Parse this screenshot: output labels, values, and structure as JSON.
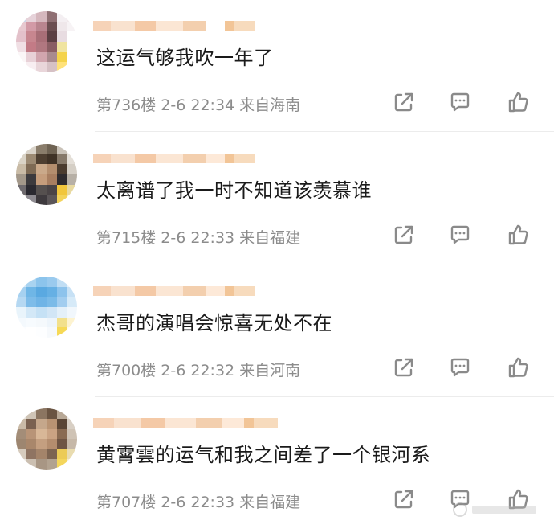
{
  "comments": [
    {
      "text": "这运气够我吹一年了",
      "meta": "第736楼 2-6 22:34 来自海南",
      "avatar_colors": [
        "#cbd6e8",
        "#e6d2d9",
        "#d5b7bd",
        "#8f6f73",
        "#f4eff2",
        "#f1e9ec",
        "#e7c8cf",
        "#d29aa6",
        "#b9858f",
        "#6c4e51",
        "#efe7ea",
        "#f7f3f5",
        "#e3c1ca",
        "#c7868f",
        "#a86e77",
        "#5c3f43",
        "#e8dce1",
        "#ffffff",
        "#f0dfe4",
        "#c37b86",
        "#b07780",
        "#8a5e64",
        "#f0e4a0",
        "#ffffff",
        "#fbf6f7",
        "#e8d1d7",
        "#d1a5ae",
        "#a98a8e",
        "#f4d34a",
        "#ffffff",
        "#ffffff",
        "#f8eef1",
        "#e9d6da",
        "#d6c1c5",
        "#ffe27a",
        "#ffffff"
      ],
      "name_colors": [
        "#f6d3b8",
        "#f9e2cf",
        "#f4c9a6",
        "#fbe6d4",
        "#f3cfae",
        "#ffffff",
        "#f2c597",
        "#f7dbbd"
      ]
    },
    {
      "text": "太离谱了我一时不知道该羡慕谁",
      "meta": "第715楼 2-6 22:33 来自福建",
      "avatar_colors": [
        "#e9e6e0",
        "#d9d3c9",
        "#8a7d6b",
        "#6f6353",
        "#c9c2b8",
        "#ece8e2",
        "#dad3c6",
        "#9c8a73",
        "#4e3f31",
        "#3f3226",
        "#86796a",
        "#e4dfd8",
        "#c9bba6",
        "#7e6a54",
        "#caa98a",
        "#b48e6e",
        "#4b3c2f",
        "#d5cfc6",
        "#a3988a",
        "#3c3a3d",
        "#c59d7c",
        "#a87e60",
        "#2e2b2e",
        "#b7b0a6",
        "#6e6a6e",
        "#2a2930",
        "#55504f",
        "#4a4446",
        "#f1c63c",
        "#e8d9a0",
        "#d7d2cc",
        "#8d8a90",
        "#3e3a3e",
        "#5b5658",
        "#f3d35a",
        "#f7e8b0"
      ],
      "name_colors": [
        "#f6d3b8",
        "#f9e2cf",
        "#f4c9a6",
        "#fbe6d4",
        "#f3cfae",
        "#fde9d8",
        "#f2c597",
        "#f7dbbd"
      ]
    },
    {
      "text": "杰哥的演唱会惊喜无处不在",
      "meta": "第700楼 2-6 22:32 来自河南",
      "avatar_colors": [
        "#d5e9f7",
        "#a9d3f0",
        "#8cc4ec",
        "#9acaee",
        "#c1def4",
        "#e7f2fa",
        "#a6d1f0",
        "#6fb6e6",
        "#5aa9e1",
        "#66b0e4",
        "#8dc3ec",
        "#c7e1f5",
        "#b5d8f2",
        "#7dbce9",
        "#6fb4e6",
        "#7bbbe8",
        "#a2cdef",
        "#d6eaf8",
        "#e9f4fb",
        "#d3e8f7",
        "#c5e1f5",
        "#d2e6f6",
        "#e4f0f9",
        "#f1f7fc",
        "#f4f9fd",
        "#f7fbfe",
        "#f5f9fc",
        "#eef5fb",
        "#f2e08c",
        "#fdf3d0",
        "#fbfdff",
        "#ffffff",
        "#fdfeff",
        "#f6f9fc",
        "#f6d957",
        "#fffaf0"
      ],
      "name_colors": [
        "#f6d3b8",
        "#f9e2cf",
        "#f4c9a6",
        "#fbe6d4",
        "#f3cfae",
        "#fde9d8",
        "#f2c597",
        "#f7dbbd"
      ]
    },
    {
      "text": "黄霄雲的运气和我之间差了一个银河系",
      "meta": "第707楼 2-6 22:33 来自福建",
      "avatar_colors": [
        "#e8e4df",
        "#cfc4b6",
        "#8b7561",
        "#6a5442",
        "#b8a896",
        "#ebe7e2",
        "#c9baa7",
        "#7a6150",
        "#c5a78b",
        "#b89373",
        "#5a4535",
        "#d8cfc4",
        "#a38d78",
        "#b89477",
        "#d8b797",
        "#caa383",
        "#8a6b52",
        "#cfc3b5",
        "#9d8670",
        "#a9876b",
        "#c49f80",
        "#b48d6e",
        "#6e5443",
        "#c6b8a8",
        "#d6cbbd",
        "#8f7462",
        "#a4846a",
        "#7d6451",
        "#eccb56",
        "#e9dcb0",
        "#eeeae4",
        "#cbbfb1",
        "#a89684",
        "#b2a290",
        "#f4d65c",
        "#f5ecd0"
      ],
      "name_colors": [
        "#f6d3b8",
        "#f9e2cf",
        "#f4c9a6",
        "#fbe6d4",
        "#f3cfae",
        "#fde9d8",
        "#f2c597",
        "#f7dbbd"
      ]
    }
  ],
  "icons": {
    "share": "share-icon",
    "reply": "comment-icon",
    "like": "thumbs-up-icon"
  },
  "colors": {
    "text": "#1a1a1a",
    "meta": "#8c8c8c",
    "icon": "#8a8a8a",
    "divider": "#ececec"
  }
}
